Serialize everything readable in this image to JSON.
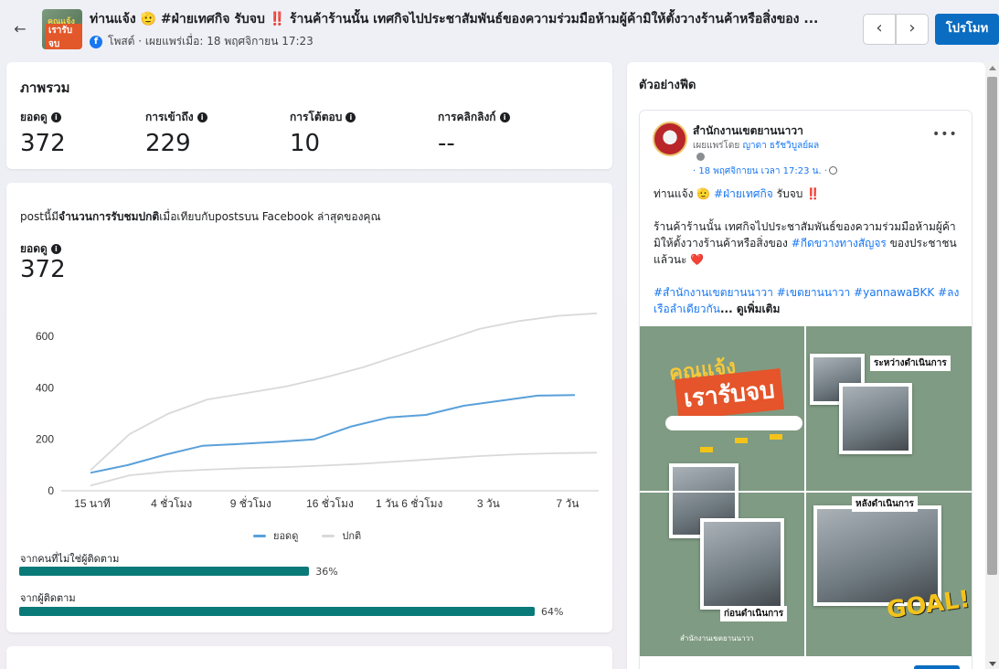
{
  "header": {
    "title": "ท่านแจ้ง 🫡 #ฝ่ายเทศกิจ รับจบ ‼️   ร้านค้าร้านนั้น เทศกิจไปประชาสัมพันธ์ของความร่วมมือห้ามผู้ค้ามิให้ตั้งวางร้านค้าหรือสิ่งของ ...",
    "meta": "โพสต์ · เผยแพร่เมื่อ: 18 พฤศจิกายน 17:23",
    "promote_label": "โปรโมท",
    "thumb_text_top": "คุณแจ้ง",
    "thumb_text_bottom": "เรารับจบ"
  },
  "overview": {
    "title": "ภาพรวม",
    "stats": [
      {
        "label": "ยอดดู",
        "value": "372"
      },
      {
        "label": "การเข้าถึง",
        "value": "229"
      },
      {
        "label": "การโต้ตอบ",
        "value": "10"
      },
      {
        "label": "การคลิกลิงก์",
        "value": "--"
      }
    ]
  },
  "comparison": {
    "text_prefix": "postนี้มี",
    "text_bold": "จำนวนการรับชมปกติ",
    "text_suffix": "เมื่อเทียบกับpostsบน Facebook ล่าสุดของคุณ",
    "views_label": "ยอดดู",
    "views_value": "372"
  },
  "chart_data": {
    "type": "line",
    "categories": [
      "15 นาที",
      "4 ชั่วโมง",
      "9 ชั่วโมง",
      "16 ชั่วโมง",
      "1 วัน 6 ชั่วโมง",
      "3 วัน",
      "7 วัน"
    ],
    "ylim": [
      0,
      700
    ],
    "yticks": [
      0,
      200,
      400,
      600
    ],
    "series": [
      {
        "name": "ยอดดู",
        "color": "#5aa0da",
        "values": [
          70,
          100,
          140,
          175,
          182,
          190,
          200,
          250,
          285,
          295,
          330,
          350,
          370,
          372
        ]
      },
      {
        "name": "ปกติ",
        "color": "#d9d9d9",
        "values": [
          80,
          220,
          300,
          355,
          380,
          405,
          440,
          480,
          530,
          580,
          630,
          660,
          680,
          690
        ]
      },
      {
        "name": "",
        "color": "#d9d9d9",
        "values": [
          20,
          60,
          75,
          82,
          88,
          92,
          98,
          105,
          115,
          125,
          135,
          142,
          146,
          148
        ]
      }
    ],
    "legend_position": "bottom"
  },
  "audience": {
    "non_followers_label": "จากคนที่ไม่ใช่ผู้ติดตาม",
    "non_followers_pct": 36,
    "non_followers_text": "36%",
    "followers_label": "จากผู้ติดตาม",
    "followers_pct": 64,
    "followers_text": "64%"
  },
  "preview": {
    "title": "ตัวอย่างฟีด",
    "page_name": "สำนักงานเขตยานนาวา",
    "published_by_prefix": "เผยแพร่โดย",
    "published_by_name": "ญาดา ธรัชวิบูลย์ผล",
    "time": "· 18 พฤศจิกายน เวลา 17:23 น. ·",
    "line1_prefix": "ท่านแจ้ง 🫡 ",
    "line1_tag": "#ฝ่ายเทศกิจ",
    "line1_suffix": " รับจบ ‼️",
    "para2_text": "      ร้านค้าร้านนั้น เทศกิจไปประชาสัมพันธ์ของความร่วมมือห้ามผู้ค้ามิให้ตั้งวางร้านค้าหรือสิ่งของ ",
    "para2_tag": "#กีดขวางทางสัญจร",
    "para2_suffix": " ของประชาชนแล้วนะ ❤️",
    "tags_line": "#สำนักงานเขตยานนาวา #เขตยานนาวา #yannawaBKK #ลงเรือลำเดียวกัน",
    "see_more": "... ดูเพิ่มเติม",
    "image_title_top": "คุณแจ้ง",
    "image_title_bottom": "เรารับจบ",
    "image_phrase_during": "ระหว่างดำเนินการ",
    "image_phrase_after": "หลังดำเนินการ",
    "image_phrase_before": "ก่อนดำเนินการ",
    "image_goal": "GOAL!",
    "image_footer": "สำนักงานเขตยานนาวา"
  }
}
